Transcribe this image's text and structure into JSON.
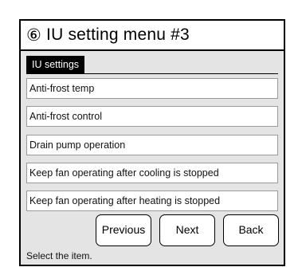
{
  "title": {
    "number": "⑥",
    "text": "IU setting menu #3"
  },
  "section": {
    "label": "IU settings"
  },
  "items": [
    {
      "label": "Anti-frost temp"
    },
    {
      "label": "Anti-frost control"
    },
    {
      "label": "Drain pump operation"
    },
    {
      "label": "Keep fan operating after cooling is stopped"
    },
    {
      "label": "Keep fan operating after heating is stopped"
    }
  ],
  "buttons": {
    "previous": "Previous",
    "next": "Next",
    "back": "Back"
  },
  "status": "Select the item."
}
